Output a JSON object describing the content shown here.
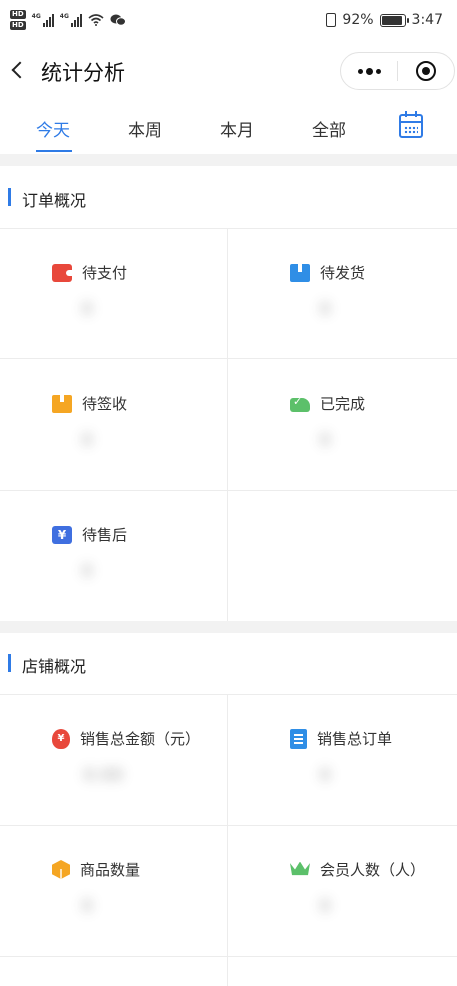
{
  "status_bar": {
    "hd1": "HD",
    "hd2": "HD",
    "net1": "4G",
    "net2": "4G",
    "battery_percent": "92%",
    "battery_level": 0.92,
    "time": "3:47"
  },
  "nav": {
    "title": "统计分析"
  },
  "tabs": [
    "今天",
    "本周",
    "本月",
    "全部"
  ],
  "active_tab": 0,
  "colors": {
    "accent": "#2f7be6",
    "wallet": "#e8483b",
    "box_blue": "#2f8ee6",
    "box_orange": "#f5a623",
    "green": "#5cc06a",
    "yen_blue": "#3f6fe0"
  },
  "order_section": {
    "title": "订单概况",
    "items": [
      {
        "label": "待支付",
        "icon": "wallet-icon",
        "value": "0"
      },
      {
        "label": "待发货",
        "icon": "package-icon",
        "value": "0"
      },
      {
        "label": "待签收",
        "icon": "box-icon",
        "value": "0"
      },
      {
        "label": "已完成",
        "icon": "delivery-truck-icon",
        "value": "0"
      },
      {
        "label": "待售后",
        "icon": "yen-card-icon",
        "value": "0"
      }
    ]
  },
  "shop_section": {
    "title": "店铺概况",
    "items": [
      {
        "label": "销售总金额（元）",
        "icon": "money-bag-icon",
        "value": "0.00"
      },
      {
        "label": "销售总订单",
        "icon": "document-icon",
        "value": "0"
      },
      {
        "label": "商品数量",
        "icon": "cube-icon",
        "value": "0"
      },
      {
        "label": "会员人数（人）",
        "icon": "crown-icon",
        "value": "0"
      }
    ]
  }
}
